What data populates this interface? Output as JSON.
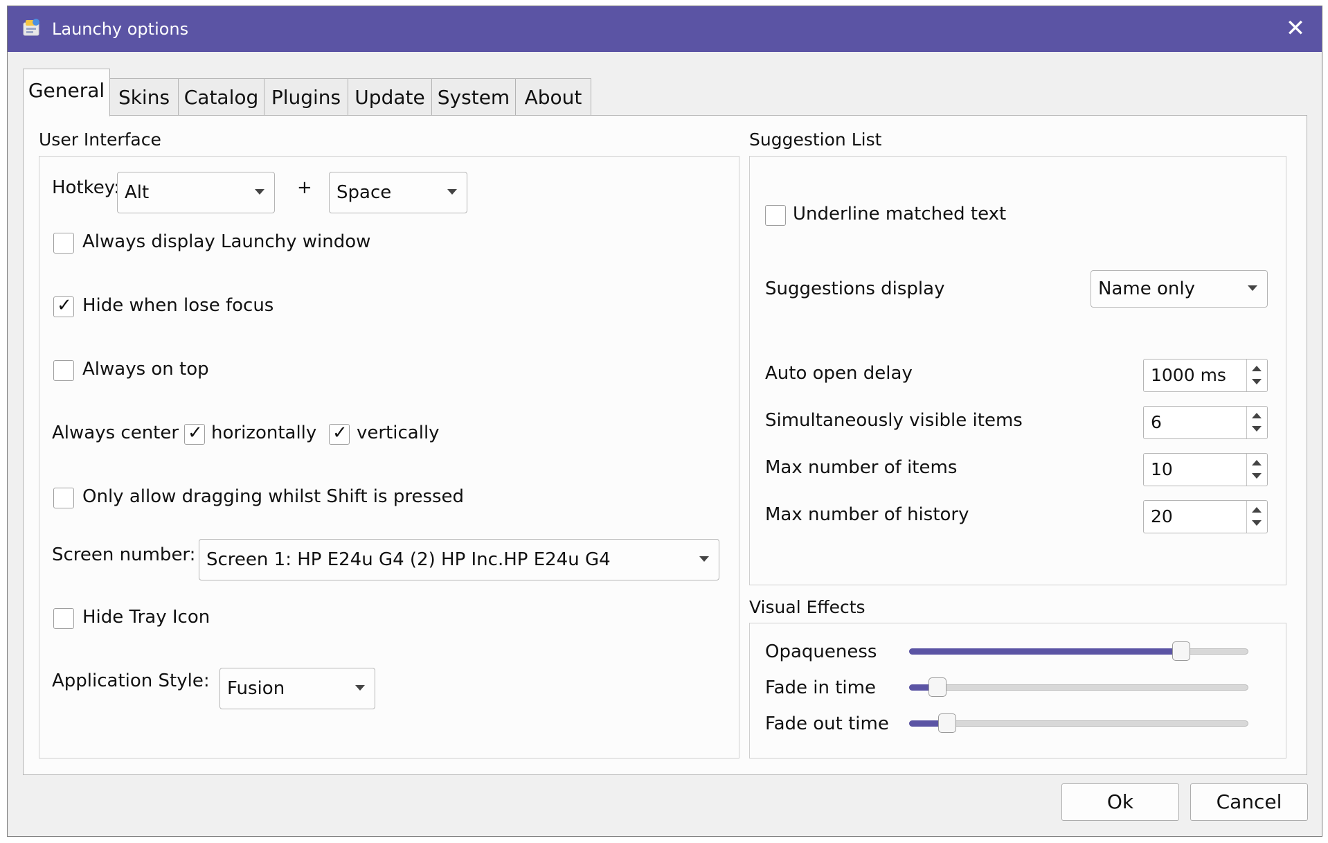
{
  "window": {
    "title": "Launchy options",
    "close_glyph": "✕",
    "accent_color": "#5b54a4"
  },
  "tabs": [
    {
      "label": "General",
      "active": true
    },
    {
      "label": "Skins"
    },
    {
      "label": "Catalog"
    },
    {
      "label": "Plugins"
    },
    {
      "label": "Update"
    },
    {
      "label": "System"
    },
    {
      "label": "About"
    }
  ],
  "user_interface": {
    "title": "User Interface",
    "hotkey_label": "Hotkey:",
    "hotkey_modifier": "Alt",
    "plus": "+",
    "hotkey_key": "Space",
    "always_display": {
      "label": "Always display Launchy window",
      "checked": false
    },
    "hide_lose_focus": {
      "label": "Hide when lose focus",
      "checked": true
    },
    "always_on_top": {
      "label": "Always on top",
      "checked": false
    },
    "always_center_label": "Always center",
    "center_horizontally": {
      "label": "horizontally",
      "checked": true
    },
    "center_vertically": {
      "label": "vertically",
      "checked": true
    },
    "drag_shift": {
      "label": "Only allow dragging whilst Shift is pressed",
      "checked": false
    },
    "screen_number_label": "Screen number:",
    "screen_number_value": "Screen 1: HP E24u G4 (2) HP Inc.HP E24u G4",
    "hide_tray": {
      "label": "Hide Tray Icon",
      "checked": false
    },
    "app_style_label": "Application Style:",
    "app_style_value": "Fusion",
    "check_glyph": "✓"
  },
  "suggestion_list": {
    "title": "Suggestion List",
    "underline": {
      "label": "Underline matched text",
      "checked": false
    },
    "display_label": "Suggestions display",
    "display_value": "Name only",
    "auto_open_label": "Auto open delay",
    "auto_open_value": "1000 ms",
    "visible_items_label": "Simultaneously visible items",
    "visible_items_value": "6",
    "max_items_label": "Max number of items",
    "max_items_value": "10",
    "max_history_label": "Max number of history",
    "max_history_value": "20"
  },
  "visual_effects": {
    "title": "Visual Effects",
    "opaqueness_label": "Opaqueness",
    "opaqueness_level": 0.82,
    "fade_in_label": "Fade in time",
    "fade_in_level": 0.06,
    "fade_out_label": "Fade out time",
    "fade_out_level": 0.09
  },
  "buttons": {
    "ok": "Ok",
    "cancel": "Cancel"
  }
}
